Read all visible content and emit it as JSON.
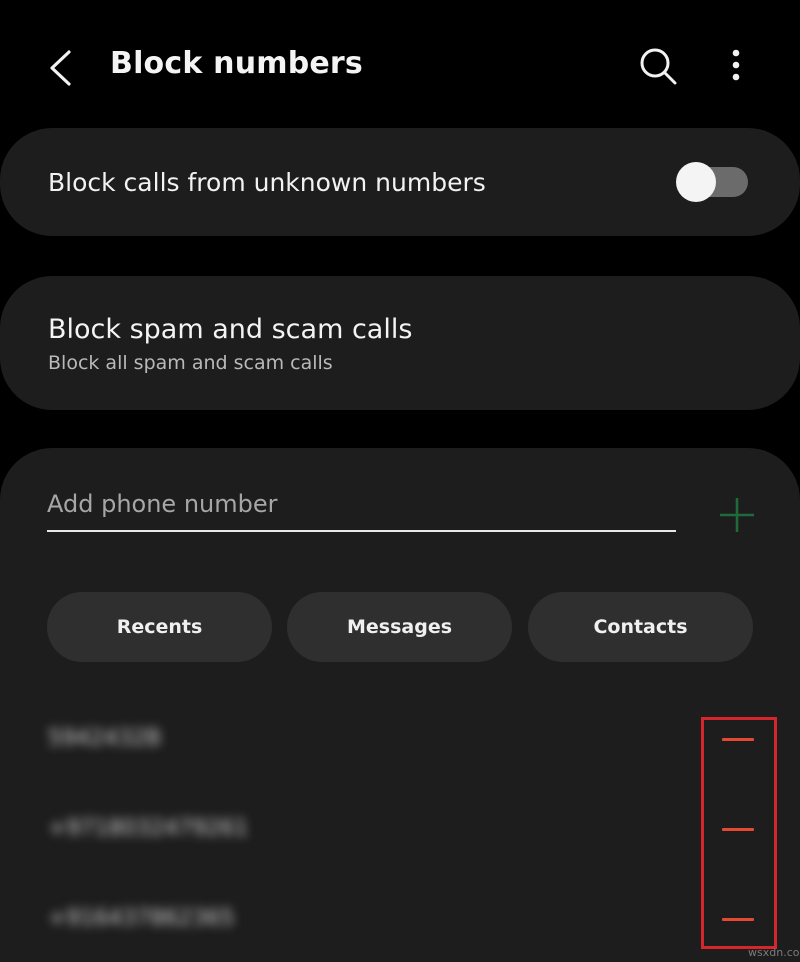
{
  "header": {
    "title": "Block numbers"
  },
  "unknown_calls": {
    "label": "Block calls from unknown numbers",
    "enabled": false
  },
  "spam_calls": {
    "title": "Block spam and scam calls",
    "subtitle": "Block all spam and scam calls"
  },
  "add_number": {
    "placeholder": "Add phone number"
  },
  "quick_buttons": {
    "recents": "Recents",
    "messages": "Messages",
    "contacts": "Contacts"
  },
  "blocked_numbers": [
    "5942432B",
    "+9718032479261",
    "+916437862365"
  ],
  "colors": {
    "accent_remove": "#e44a33",
    "highlight_box": "#d5252d",
    "add_icon": "#1f6b3a"
  },
  "watermark": "wsxdn.com"
}
